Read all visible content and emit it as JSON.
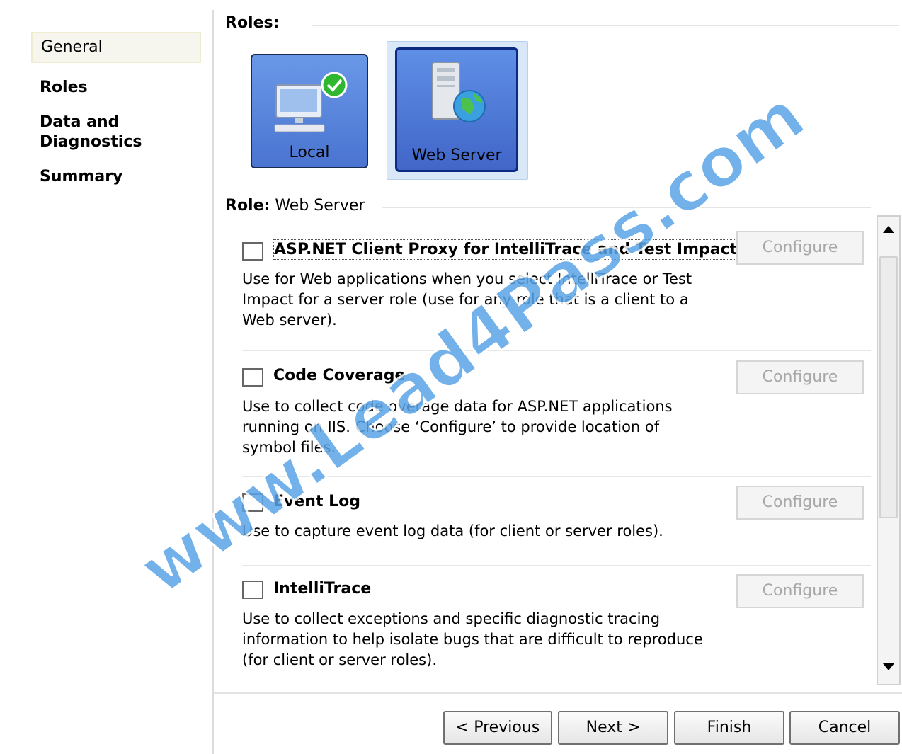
{
  "nav": {
    "items": [
      {
        "label": "General",
        "selected": true
      },
      {
        "label": "Roles",
        "selected": false
      },
      {
        "label": "Data and\nDiagnostics",
        "selected": false
      },
      {
        "label": "Summary",
        "selected": false
      }
    ]
  },
  "roles_section": {
    "title": "Roles:",
    "tiles": [
      {
        "label": "Local",
        "icon": "computer-check-icon",
        "selected": false
      },
      {
        "label": "Web Server",
        "icon": "web-server-globe-icon",
        "selected": true
      }
    ]
  },
  "role_section": {
    "title_bold": "Role:",
    "title_value": "Web Server"
  },
  "diagnostics": [
    {
      "title": "ASP.NET Client Proxy for IntelliTrace and Test Impact",
      "desc": [
        "Use for Web applications when you select IntelliTrace or Test",
        "Impact for a server role (use for any role that is a client to a",
        "Web server)."
      ],
      "checked": false,
      "configure": "Configure"
    },
    {
      "title": "Code Coverage",
      "desc": [
        "Use to collect code overage data for ASP.NET applications",
        "running on IIS. Choose ‘Configure’ to provide location of",
        "symbol files."
      ],
      "checked": false,
      "configure": "Configure"
    },
    {
      "title": "Event Log",
      "desc": [
        "Use to capture event log data (for client or server roles)."
      ],
      "checked": false,
      "configure": "Configure"
    },
    {
      "title": "IntelliTrace",
      "desc": [
        "Use to collect exceptions and specific diagnostic tracing",
        "information to help isolate bugs that are difficult to reproduce",
        "(for client or server roles)."
      ],
      "checked": false,
      "configure": "Configure"
    }
  ],
  "buttons": {
    "previous": "< Previous",
    "next": "Next >",
    "finish": "Finish",
    "cancel": "Cancel"
  },
  "watermark": "www.Lead4Pass.com",
  "colors": {
    "tile_blue": "#4a74d0",
    "tile_selected_border": "#0b2a80",
    "watermark": "#5aa4e6"
  }
}
